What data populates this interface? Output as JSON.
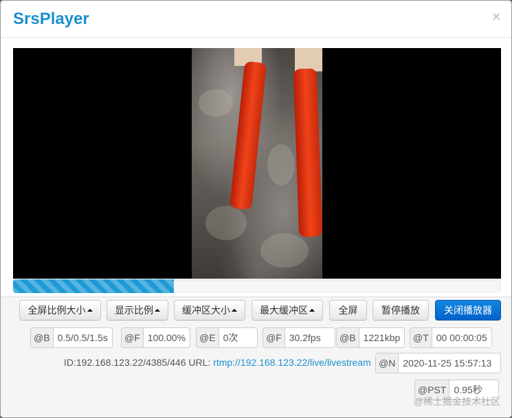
{
  "header": {
    "title": "SrsPlayer",
    "close_glyph": "×"
  },
  "progress": {
    "fraction": 0.33
  },
  "buttons": {
    "fullscreen_ratio": "全屏比例大小",
    "display_ratio": "显示比例",
    "buffer_size": "缓冲区大小",
    "max_buffer": "最大缓冲区",
    "fullscreen": "全屏",
    "pause": "暂停播放",
    "close_player": "关闭播放器"
  },
  "stats": [
    {
      "label": "@B",
      "value": "0.5/0.5/1.5s"
    },
    {
      "label": "@F",
      "value": "100.00%"
    },
    {
      "label": "@E",
      "value": "0次"
    },
    {
      "label": "@F",
      "value": "30.2fps"
    },
    {
      "label": "@B",
      "value": "1221kbp"
    },
    {
      "label": "@T",
      "value": "00 00:00:05"
    }
  ],
  "stream": {
    "id_text": "ID:192.168.123.22/4385/446 URL: ",
    "url": "rtmp://192.168.123.22/live/livestream"
  },
  "stat_n": {
    "label": "@N",
    "value": "2020-11-25 15:57:13"
  },
  "stat_pst": {
    "label": "@PST",
    "value": "0.95秒"
  },
  "watermark": "@稀土掘金技术社区",
  "colors": {
    "title": "#1c8fcf",
    "progress": "#1e9ad6",
    "primary_button": "#0462c9",
    "link": "#1c8fcf"
  }
}
